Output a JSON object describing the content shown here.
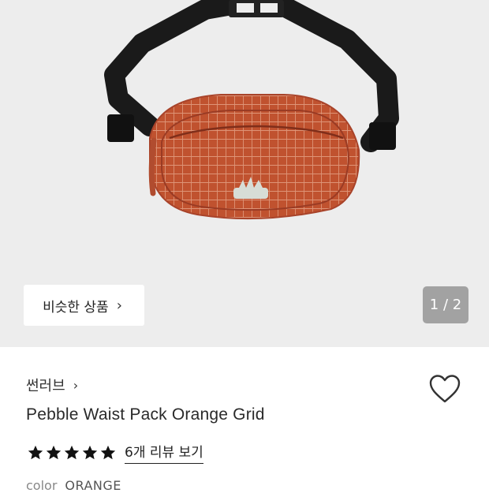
{
  "hero": {
    "similar_button_label": "비슷한 상품",
    "similar_button_chevron": "›",
    "image_counter": "1 / 2"
  },
  "product": {
    "brand": "썬러브",
    "brand_chevron": "›",
    "name": "Pebble Waist Pack Orange Grid",
    "rating_stars": 5,
    "review_link": "6개 리뷰 보기",
    "color_label": "color",
    "color_value": "ORANGE"
  },
  "icons": {
    "wishlist": "heart-outline-icon",
    "rating": "star-filled-icon"
  },
  "colors": {
    "hero_bg": "#ededed",
    "bag_orange": "#c0522f",
    "strap": "#1a1a1a",
    "counter_bg": "#8c8c8c"
  }
}
